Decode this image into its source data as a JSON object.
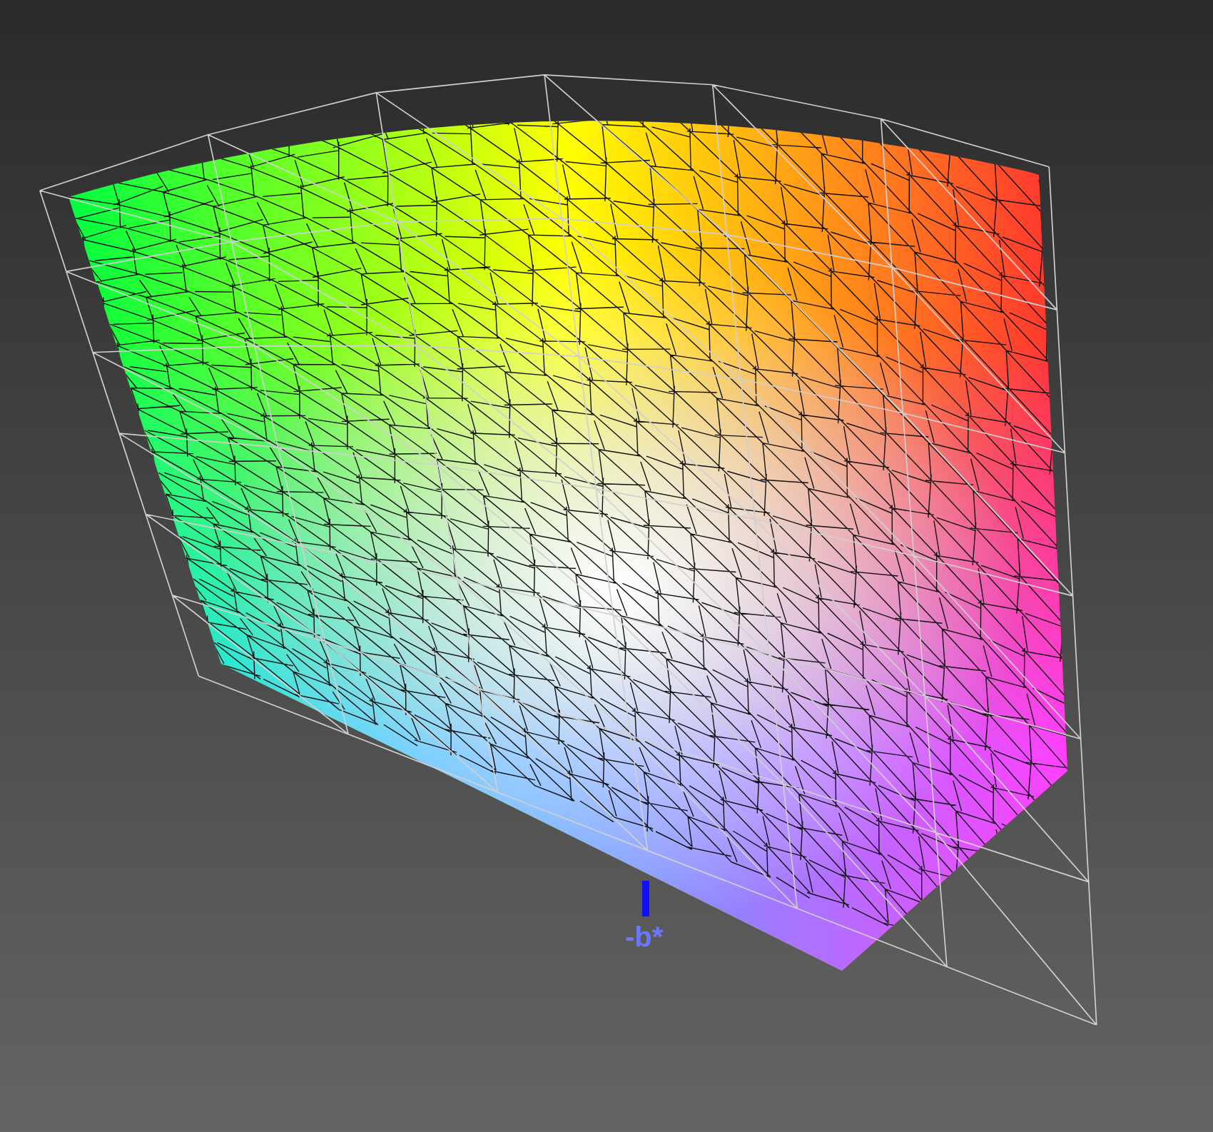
{
  "axis_label": {
    "text": "-b*"
  }
}
